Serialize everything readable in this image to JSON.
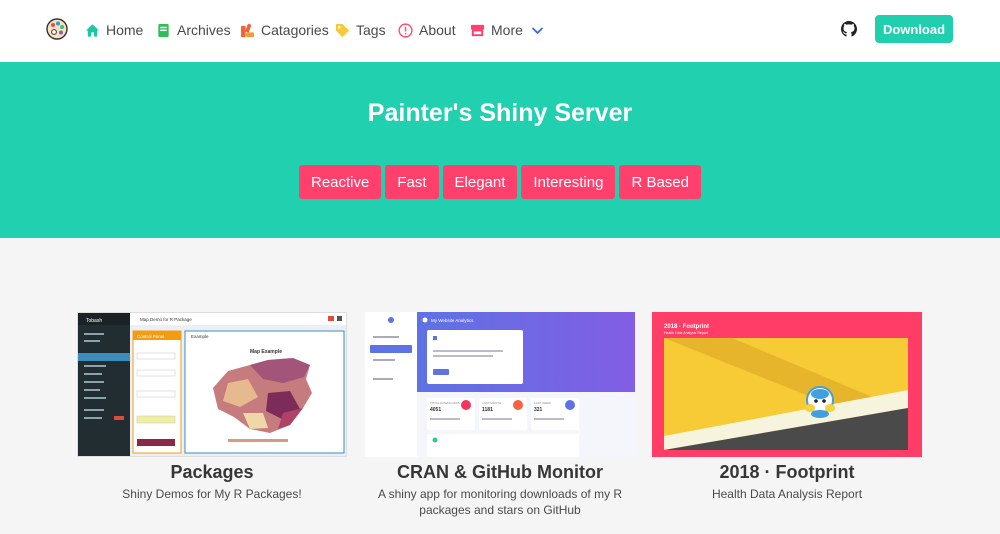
{
  "nav": {
    "items": [
      {
        "label": "Home",
        "icon": "home-icon"
      },
      {
        "label": "Archives",
        "icon": "book-icon"
      },
      {
        "label": "Catagories",
        "icon": "categories-icon"
      },
      {
        "label": "Tags",
        "icon": "tag-icon"
      },
      {
        "label": "About",
        "icon": "info-icon"
      },
      {
        "label": "More",
        "icon": "store-icon"
      }
    ],
    "download_label": "Download"
  },
  "hero": {
    "title": "Painter's Shiny Server",
    "tags": [
      "Reactive",
      "Fast",
      "Elegant",
      "Interesting",
      "R Based"
    ]
  },
  "cards": [
    {
      "title": "Packages",
      "desc": "Shiny Demos for My R Packages!"
    },
    {
      "title": "CRAN & GitHub Monitor",
      "desc": "A shiny app for monitoring downloads of my R packages and stars on GitHub"
    },
    {
      "title": "2018 · Footprint",
      "desc": "Health Data Analysis Report"
    }
  ],
  "thumbs": {
    "packages": {
      "sidebar_title": "Tobash",
      "toolbar_title": "Map Demo for R Package",
      "panel_title": "Control Panel",
      "plot_tab": "Example",
      "map_title": "Map Example"
    },
    "monitor": {
      "header_title": "My Website Analytics",
      "stats": [
        {
          "label": "TOTAL DOWNLOADS",
          "value": "4051"
        },
        {
          "label": "LAST MONTH",
          "value": "1181"
        },
        {
          "label": "LAST WEEK",
          "value": "321"
        }
      ]
    },
    "footprint": {
      "title": "2018 · Footprint",
      "subtitle": "Health Data Analysis Report"
    }
  },
  "colors": {
    "accent": "#21d0ae",
    "tag": "#ff3f6c",
    "download": "#1fcfae",
    "footprint_frame": "#ff3d66",
    "footprint_road": "#f6cb35"
  }
}
